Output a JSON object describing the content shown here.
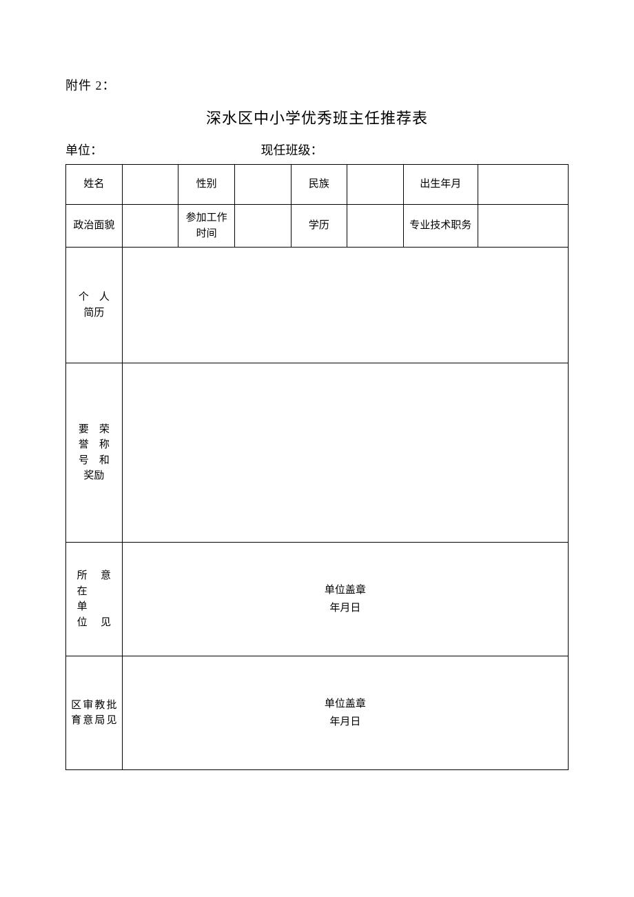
{
  "attachment": "附件 2：",
  "title": "深水区中小学优秀班主任推荐表",
  "meta": {
    "unit_label": "单位：",
    "class_label": "现任班级："
  },
  "labels": {
    "name": "姓名",
    "gender": "性别",
    "ethnicity": "民族",
    "birth": "出生年月",
    "political": "政治面貌",
    "work_start": "参加工作时间",
    "education": "学历",
    "tech_title": "专业技术职务",
    "resume_l1": "个　人",
    "resume_l2": "简历",
    "honor_l1": "要　荣",
    "honor_l2": "誉　称",
    "honor_l3": "号　和",
    "honor_l4": "奖励",
    "unit_opinion_c1": "所",
    "unit_opinion_c2": "在",
    "unit_opinion_c3": "单",
    "unit_opinion_c4": "位",
    "unit_opinion_c5": "意",
    "unit_opinion_c6": "见",
    "bureau_c1": "区",
    "bureau_c2": "育",
    "bureau_c3": "审",
    "bureau_c4": "意",
    "bureau_c5": "教",
    "bureau_c6": "局",
    "bureau_c7": "批",
    "bureau_c8": "见"
  },
  "sign": {
    "stamp": "单位盖章",
    "date": "年月日"
  }
}
